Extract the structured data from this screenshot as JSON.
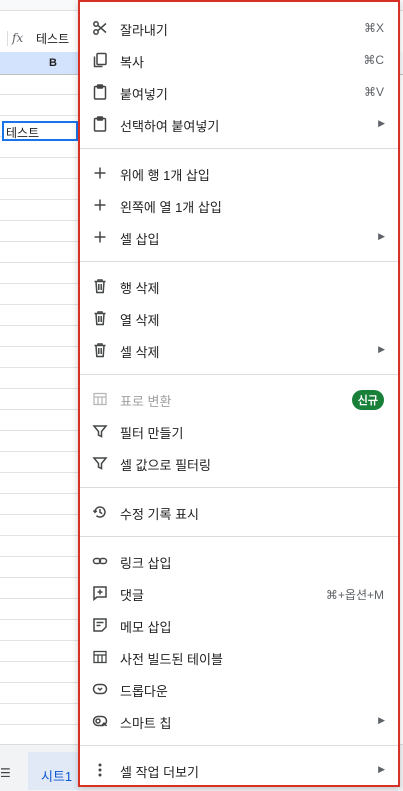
{
  "sheet": {
    "formula_value": "테스트",
    "column_b": "B",
    "active_cell_text": "테스트",
    "tab_label": "시트1",
    "menu_icon_glyph": "☰"
  },
  "menu": {
    "cut": {
      "label": "잘라내기",
      "shortcut": "⌘X",
      "icon": "scissors-icon"
    },
    "copy": {
      "label": "복사",
      "shortcut": "⌘C",
      "icon": "copy-icon"
    },
    "paste": {
      "label": "붙여넣기",
      "shortcut": "⌘V",
      "icon": "clipboard-icon"
    },
    "paste_special": {
      "label": "선택하여 붙여넣기",
      "arrow": "▶",
      "icon": "clipboard-icon"
    },
    "insert_row": {
      "label": "위에 행 1개 삽입",
      "icon": "plus-icon"
    },
    "insert_col": {
      "label": "왼쪽에 열 1개 삽입",
      "icon": "plus-icon"
    },
    "insert_cells": {
      "label": "셀 삽입",
      "arrow": "▶",
      "icon": "plus-icon"
    },
    "delete_row": {
      "label": "행 삭제",
      "icon": "trash-icon"
    },
    "delete_col": {
      "label": "열 삭제",
      "icon": "trash-icon"
    },
    "delete_cells": {
      "label": "셀 삭제",
      "arrow": "▶",
      "icon": "trash-icon"
    },
    "convert_table": {
      "label": "표로 변환",
      "badge": "신규",
      "icon": "table-icon"
    },
    "create_filter": {
      "label": "필터 만들기",
      "icon": "filter-icon"
    },
    "filter_by_value": {
      "label": "셀 값으로 필터링",
      "icon": "filter-icon"
    },
    "show_history": {
      "label": "수정 기록 표시",
      "icon": "history-icon"
    },
    "insert_link": {
      "label": "링크 삽입",
      "icon": "link-icon"
    },
    "comment": {
      "label": "댓글",
      "shortcut": "⌘+옵션+M",
      "icon": "comment-add-icon"
    },
    "insert_note": {
      "label": "메모 삽입",
      "icon": "note-icon"
    },
    "prebuilt_table": {
      "label": "사전 빌드된 테이블",
      "icon": "table-icon"
    },
    "dropdown": {
      "label": "드롭다운",
      "icon": "dropdown-icon"
    },
    "smart_chips": {
      "label": "스마트 칩",
      "arrow": "▶",
      "icon": "smart-chip-icon"
    },
    "more_actions": {
      "label": "셀 작업 더보기",
      "arrow": "▶",
      "icon": "more-vert-icon"
    }
  }
}
